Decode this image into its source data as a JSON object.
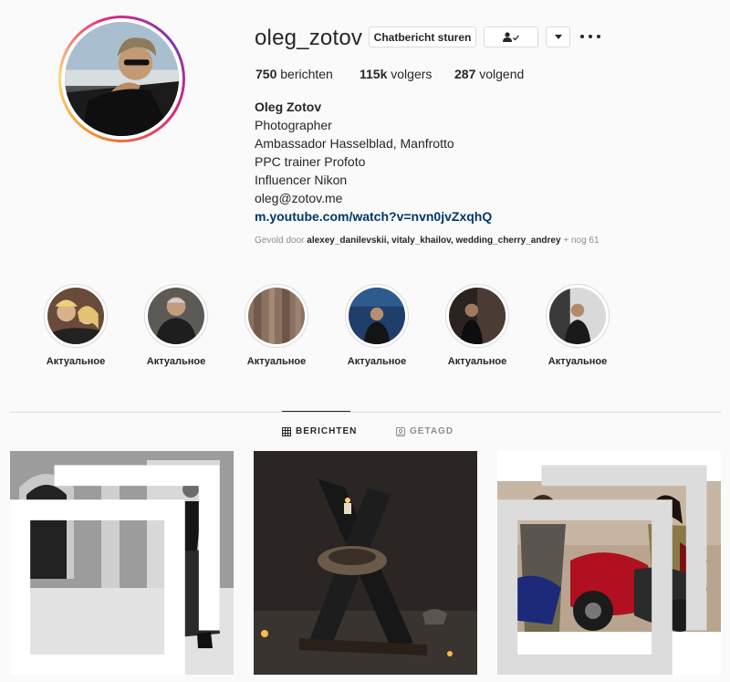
{
  "profile": {
    "username": "oleg_zotov",
    "buttons": {
      "message": "Chatbericht sturen",
      "following_icon": "person-check-icon",
      "dropdown_icon": "caret-down-icon",
      "more_icon": "more-dots-icon"
    },
    "stats": {
      "posts_count": "750",
      "posts_label": "berichten",
      "followers_count": "115k",
      "followers_label": "volgers",
      "following_count": "287",
      "following_label": "volgend"
    },
    "bio": {
      "full_name": "Oleg Zotov",
      "lines": [
        "Photographer",
        "Ambassador Hasselblad, Manfrotto",
        "PPC trainer Profoto",
        "Influencer Nikon",
        "oleg@zotov.me"
      ],
      "link": "m.youtube.com/watch?v=nvn0jvZxqhQ"
    },
    "followed_by": {
      "prefix": "Gevold door",
      "names": "alexey_danilevskii, vitaly_khailov, wedding_cherry_andrey",
      "suffix": "+ nog 61"
    }
  },
  "highlights": [
    {
      "label": "Актуальное"
    },
    {
      "label": "Актуальное"
    },
    {
      "label": "Актуальное"
    },
    {
      "label": "Актуальное"
    },
    {
      "label": "Актуальное"
    },
    {
      "label": "Актуальное"
    }
  ],
  "tabs": {
    "posts": "BERICHTEN",
    "tagged": "GETAGD"
  },
  "colors": {
    "link": "#00376b",
    "muted": "#8e8e8e",
    "border": "#dbdbdb",
    "background": "#fafafa"
  }
}
